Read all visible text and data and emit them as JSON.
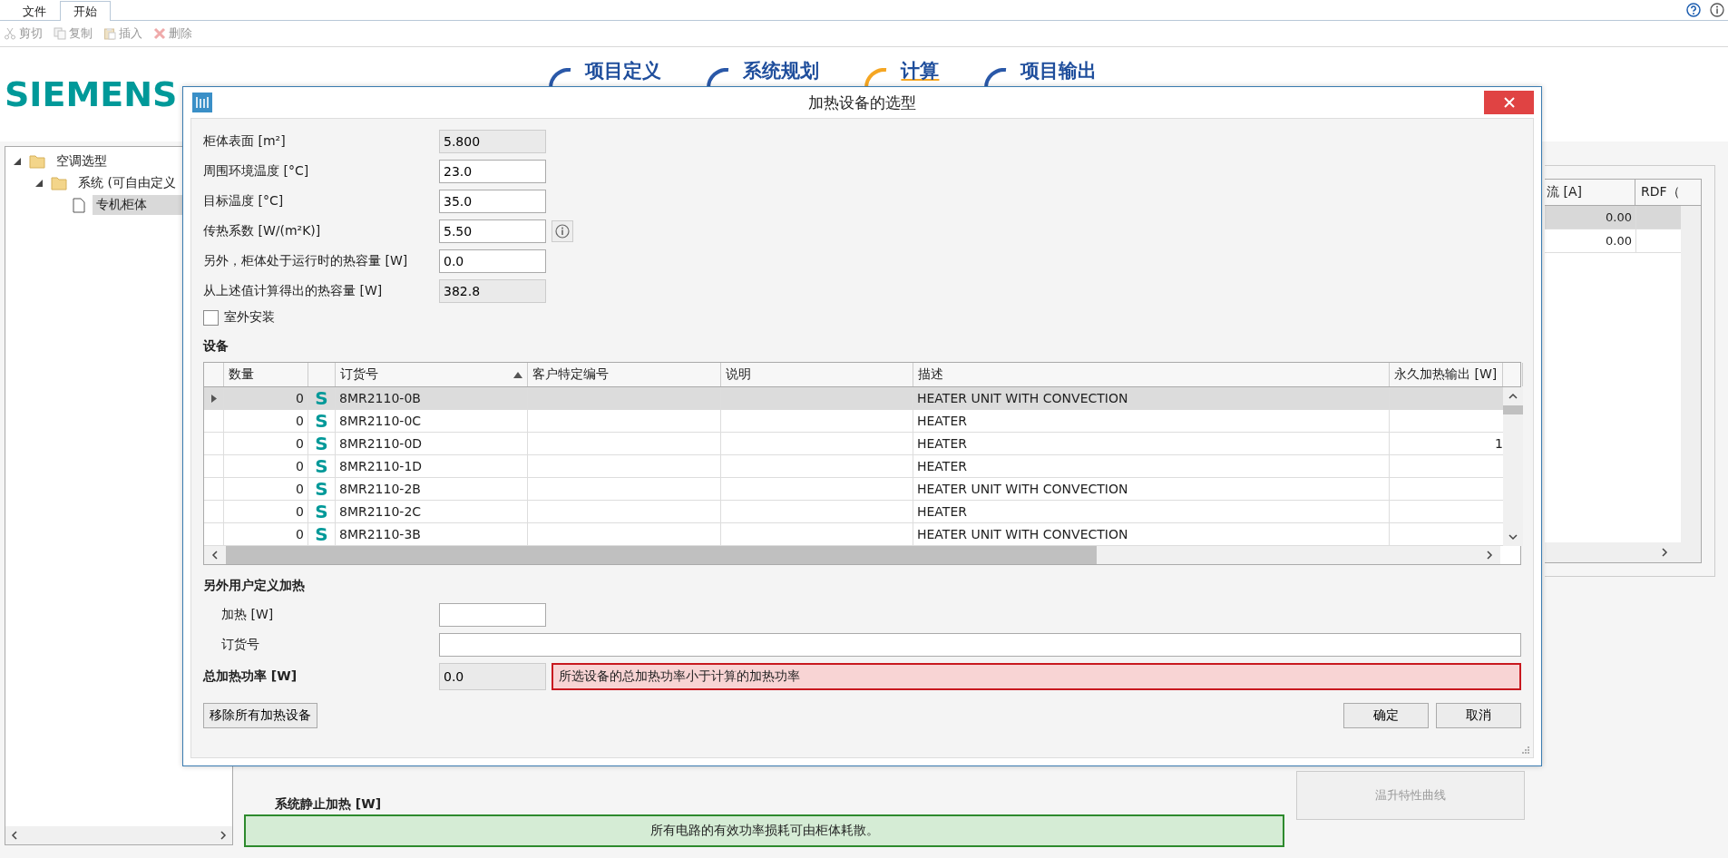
{
  "menu_tabs": [
    {
      "label": "文件",
      "selected": false
    },
    {
      "label": "开始",
      "selected": true
    }
  ],
  "toolbar": [
    {
      "kind": "cut",
      "label": "剪切",
      "disabled": true
    },
    {
      "kind": "copy",
      "label": "复制",
      "disabled": true
    },
    {
      "kind": "paste",
      "label": "插入",
      "disabled": true
    },
    {
      "kind": "delete",
      "label": "删除",
      "disabled": true
    }
  ],
  "logo": "SIEMENS",
  "steps": [
    {
      "label": "项目定义",
      "selected": false
    },
    {
      "label": "系统规划",
      "selected": false
    },
    {
      "label": "计算",
      "selected": true
    },
    {
      "label": "项目输出",
      "selected": false
    }
  ],
  "tree": [
    {
      "kind": "folder",
      "label": "空调选型",
      "expanded": true,
      "selected": false,
      "children": [
        {
          "kind": "folder",
          "label": "系统 (可自由定义",
          "expanded": true,
          "selected": false,
          "children": [
            {
              "kind": "document",
              "label": "专机柜体",
              "selected": true
            }
          ]
        }
      ]
    }
  ],
  "right_table": {
    "columns": [
      "流 [A]",
      "RDF（"
    ],
    "rows": [
      {
        "current": "0.00",
        "selected": true
      },
      {
        "current": "0.00",
        "selected": false
      }
    ]
  },
  "summary_labels": [
    "系统静止加热 [W]"
  ],
  "curve_button": {
    "label": "温升特性曲线",
    "disabled": true
  },
  "status_message": "所有电路的有效功率损耗可由柜体耗散。",
  "dialog": {
    "title": "加热设备的选型",
    "fields": [
      {
        "label": "柜体表面 [m²]",
        "value": "5.800",
        "readonly": true,
        "info": false
      },
      {
        "label": "周围环境温度 [°C]",
        "value": "23.0",
        "readonly": false,
        "info": false
      },
      {
        "label": "目标温度 [°C]",
        "value": "35.0",
        "readonly": false,
        "info": false
      },
      {
        "label": "传热系数 [W/(m²K)]",
        "value": "5.50",
        "readonly": false,
        "info": true
      },
      {
        "label": "另外，柜体处于运行时的热容量 [W]",
        "value": "0.0",
        "readonly": false,
        "info": false
      },
      {
        "label": "从上述值计算得出的热容量 [W]",
        "value": "382.8",
        "readonly": true,
        "info": false
      }
    ],
    "outdoor": {
      "label": "室外安装",
      "checked": false
    },
    "devices_heading": "设备",
    "columns": [
      {
        "label": "数量",
        "sorted": false
      },
      {
        "label": "订货号",
        "sorted": true
      },
      {
        "label": "客户特定编号",
        "sorted": false
      },
      {
        "label": "说明",
        "sorted": false
      },
      {
        "label": "描述",
        "sorted": false
      },
      {
        "label": "永久加热输出 [W]",
        "sorted": false
      }
    ],
    "rows": [
      {
        "qty": "0",
        "icon": "S",
        "order_no": "8MR2110-0B",
        "description": "HEATER UNIT WITH CONVECTION",
        "selected": true
      },
      {
        "qty": "0",
        "icon": "S",
        "order_no": "8MR2110-0C",
        "description": "HEATER",
        "selected": false
      },
      {
        "qty": "0",
        "icon": "S",
        "order_no": "8MR2110-0D",
        "description": "HEATER",
        "output": "1",
        "selected": false
      },
      {
        "qty": "0",
        "icon": "S",
        "order_no": "8MR2110-1D",
        "description": "HEATER",
        "selected": false
      },
      {
        "qty": "0",
        "icon": "S",
        "order_no": "8MR2110-2B",
        "description": "HEATER UNIT WITH CONVECTION",
        "selected": false
      },
      {
        "qty": "0",
        "icon": "S",
        "order_no": "8MR2110-2C",
        "description": "HEATER",
        "selected": false
      },
      {
        "qty": "0",
        "icon": "S",
        "order_no": "8MR2110-3B",
        "description": "HEATER UNIT WITH CONVECTION",
        "selected": false
      }
    ],
    "custom_heading": "另外用户定义加热",
    "heat_label": "加热 [W]",
    "order_label": "订货号",
    "total": {
      "label": "总加热功率 [W]",
      "value": "0.0"
    },
    "error": "所选设备的总加热功率小于计算的加热功率",
    "remove_button": "移除所有加热设备",
    "ok_button": "确定",
    "cancel_button": "取消"
  }
}
